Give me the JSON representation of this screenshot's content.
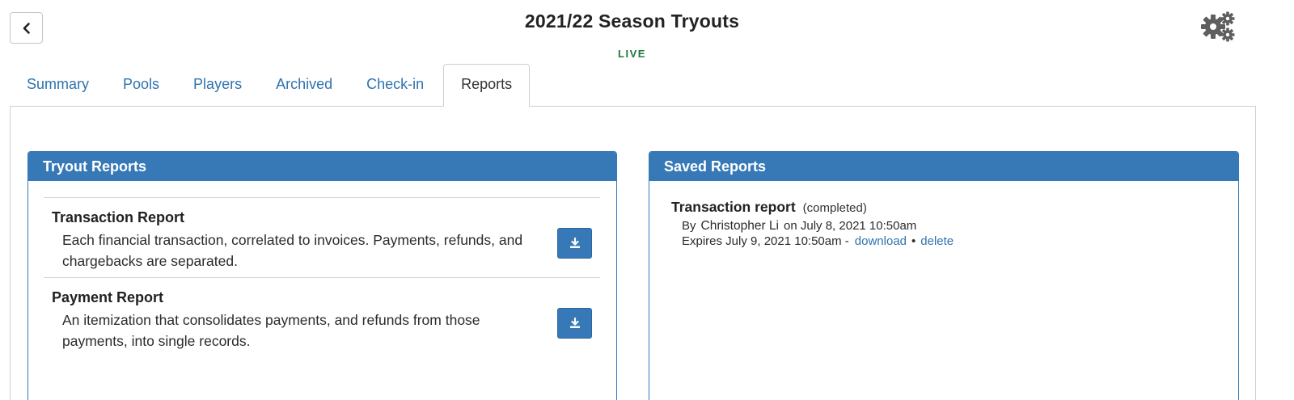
{
  "header": {
    "title": "2021/22 Season Tryouts",
    "status": "LIVE",
    "status_color": "#1e7a3c",
    "back_icon": "chevron-left-icon",
    "settings_icon": "gears-icon"
  },
  "tabs": [
    {
      "label": "Summary",
      "active": false
    },
    {
      "label": "Pools",
      "active": false
    },
    {
      "label": "Players",
      "active": false
    },
    {
      "label": "Archived",
      "active": false
    },
    {
      "label": "Check-in",
      "active": false
    },
    {
      "label": "Reports",
      "active": true
    }
  ],
  "tryout_reports": {
    "title": "Tryout Reports",
    "items": [
      {
        "title": "Transaction Report",
        "description": "Each financial transaction, correlated to invoices. Payments, refunds, and chargebacks are separated.",
        "download_icon": "download-icon"
      },
      {
        "title": "Payment Report",
        "description": "An itemization that consolidates payments, and refunds from those payments, into single records.",
        "download_icon": "download-icon"
      }
    ]
  },
  "saved_reports": {
    "title": "Saved Reports",
    "items": [
      {
        "title": "Transaction report",
        "status": "(completed)",
        "by_label": "By",
        "author": "Christopher Li",
        "created": "on July 8, 2021 10:50am",
        "expires": "Expires July 9, 2021 10:50am -",
        "download_label": "download",
        "separator": "•",
        "delete_label": "delete"
      }
    ]
  },
  "colors": {
    "accent": "#3679b6",
    "link": "#2f73ae"
  }
}
